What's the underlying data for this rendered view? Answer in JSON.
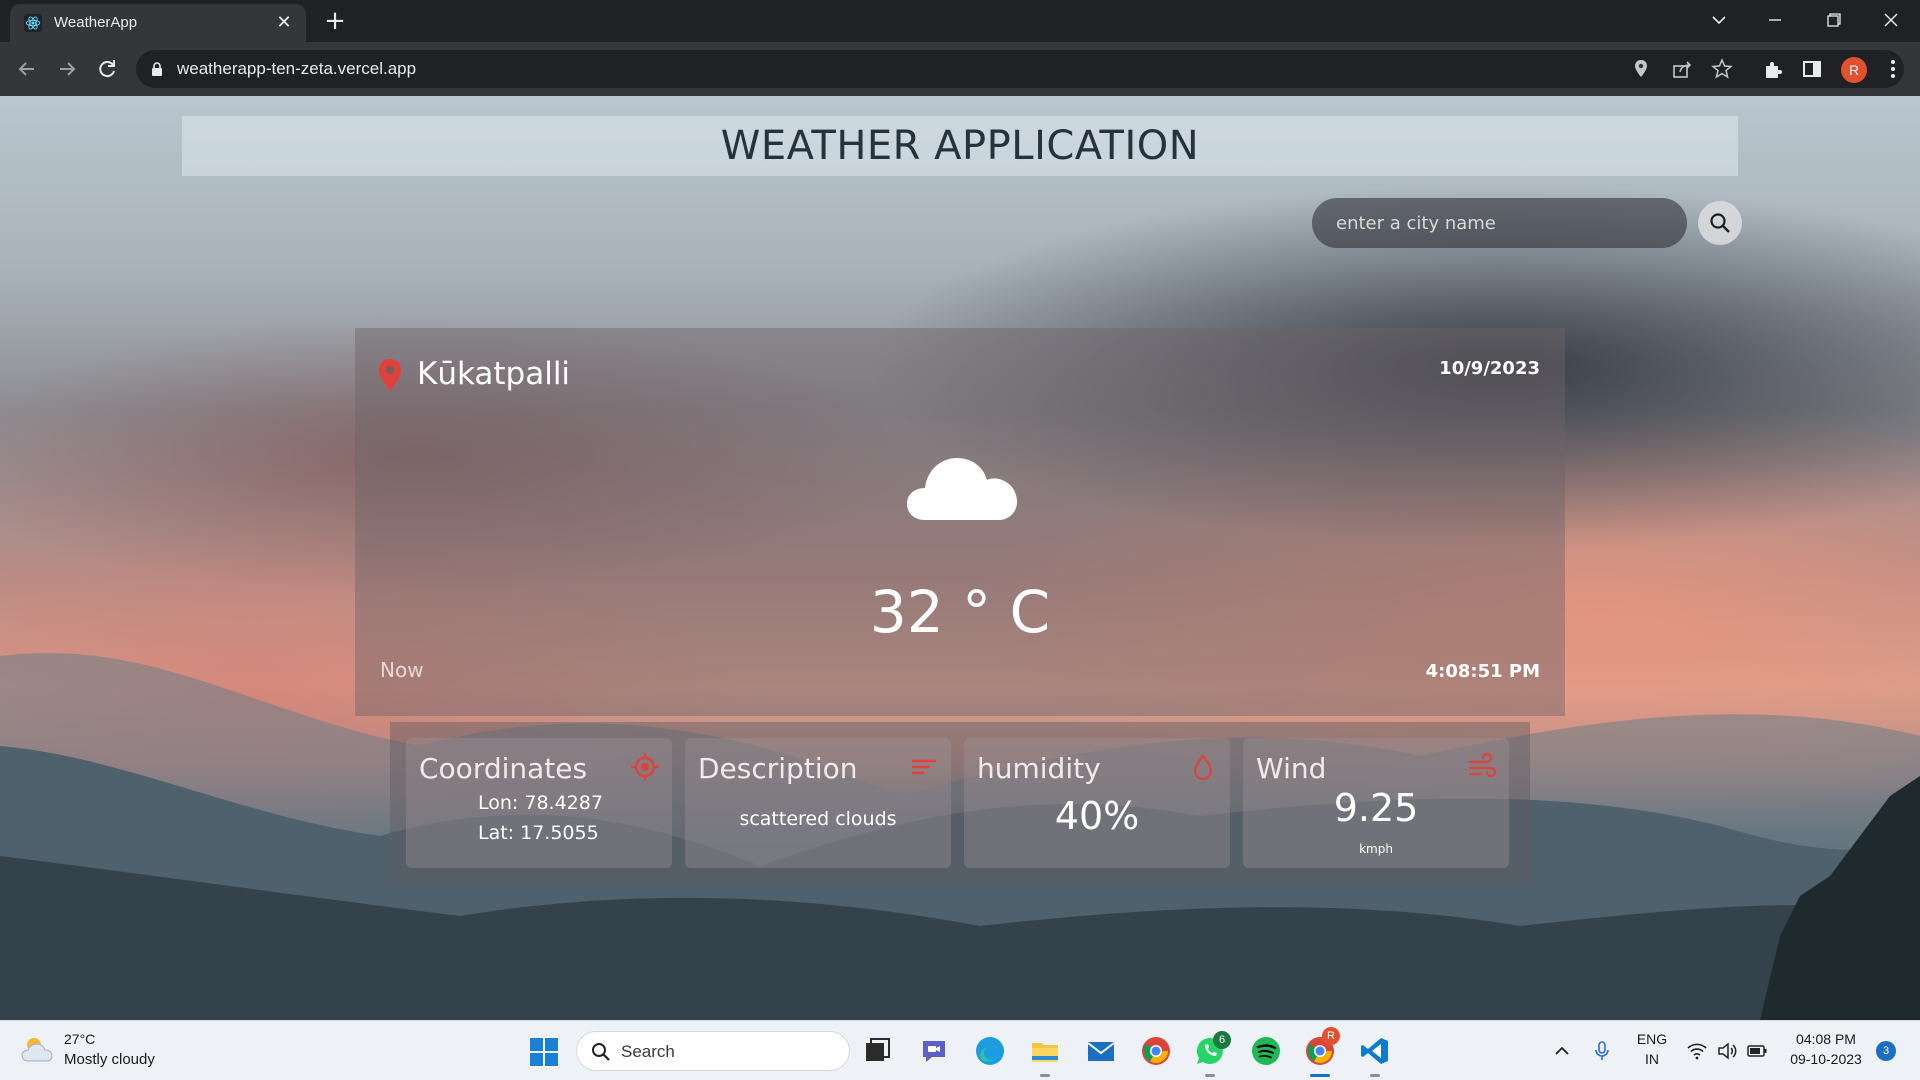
{
  "browser": {
    "tab_title": "WeatherApp",
    "new_tab_symbol": "+",
    "close_symbol": "✕",
    "url": "weatherapp-ten-zeta.vercel.app",
    "profile_initial": "R"
  },
  "app": {
    "title": "WEATHER APPLICATION",
    "search_placeholder": "enter a city name",
    "city": "Kūkatpalli",
    "date": "10/9/2023",
    "temperature": "32 ° C",
    "now_label": "Now",
    "time": "4:08:51 PM",
    "condition_icon": "cloud-icon",
    "details": {
      "coordinates": {
        "title": "Coordinates",
        "lon": "Lon:  78.4287",
        "lat": "Lat:  17.5055"
      },
      "description": {
        "title": "Description",
        "value": "scattered clouds"
      },
      "humidity": {
        "title": "humidity",
        "value": "40%"
      },
      "wind": {
        "title": "Wind",
        "value": "9.25",
        "unit": "kmph"
      }
    },
    "accent_color": "#e0413a"
  },
  "taskbar": {
    "weather_temp": "27°C",
    "weather_condition": "Mostly cloudy",
    "search_label": "Search",
    "whatsapp_badge": "6",
    "chrome_profile_badge": "R",
    "language": "ENG",
    "region": "IN",
    "time": "04:08 PM",
    "date": "09-10-2023",
    "notification_count": "3"
  }
}
